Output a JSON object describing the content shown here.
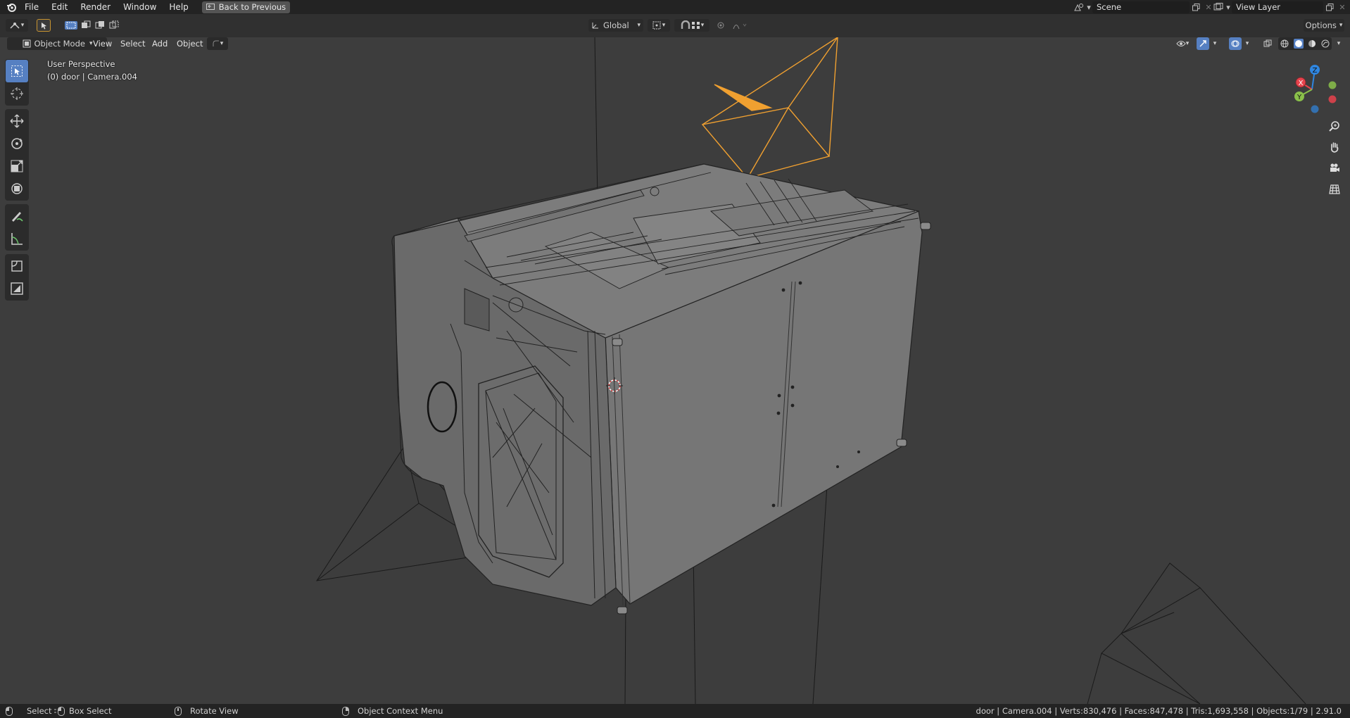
{
  "menu": {
    "items": [
      "File",
      "Edit",
      "Render",
      "Window",
      "Help"
    ],
    "back_button": "Back to Previous"
  },
  "scene": {
    "name": "Scene"
  },
  "view_layer": {
    "name": "View Layer"
  },
  "header": {
    "transform_orientation": "Global",
    "options_label": "Options"
  },
  "view_header": {
    "mode": "Object Mode",
    "menus": [
      "View",
      "Select",
      "Add",
      "Object"
    ]
  },
  "viewport": {
    "perspective_label": "User Perspective",
    "object_label": "(0) door | Camera.004",
    "gizmo_axes": {
      "x": "X",
      "y": "Y",
      "z": "Z"
    }
  },
  "toolbar": {
    "tools": [
      "select-box",
      "cursor",
      "move",
      "rotate",
      "scale",
      "transform",
      "annotate",
      "measure",
      "add-cube",
      "extrude"
    ]
  },
  "statusbar": {
    "select": "Select",
    "box_select": "Box Select",
    "rotate_view": "Rotate View",
    "context_menu": "Object Context Menu",
    "stats": "door | Camera.004 | Verts:830,476 | Faces:847,478 | Tris:1,693,558 | Objects:1/79 | 2.91.0"
  },
  "colors": {
    "accent": "#5680c2",
    "camera_selected": "#f0a030",
    "axis_x": "#e8424c",
    "axis_y": "#8ac04a",
    "axis_z": "#2f86e0"
  }
}
